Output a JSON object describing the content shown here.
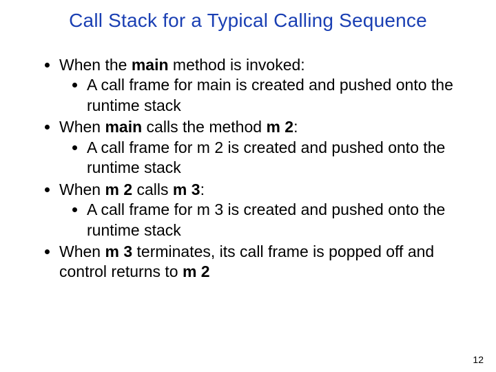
{
  "title": "Call Stack for a Typical Calling Sequence",
  "bullets": {
    "i0": {
      "t1": "When the ",
      "b1": "main",
      "t2": " method is invoked:",
      "sub": {
        "t1": "A call frame for main is created and pushed onto the runtime stack"
      }
    },
    "i1": {
      "t1": "When ",
      "b1": "main",
      "t2": " calls the method ",
      "b2": "m 2",
      "t3": ":",
      "sub": {
        "t1": "A call frame for m 2 is created and pushed onto the runtime stack"
      }
    },
    "i2": {
      "t1": "When ",
      "b1": "m 2",
      "t2": " calls ",
      "b2": "m 3",
      "t3": ":",
      "sub": {
        "t1": "A call frame for m 3 is created and pushed onto the runtime stack"
      }
    },
    "i3": {
      "t1": "When ",
      "b1": "m 3",
      "t2": " terminates, its call frame is popped off and control returns to ",
      "b2": "m 2"
    }
  },
  "page_number": "12"
}
